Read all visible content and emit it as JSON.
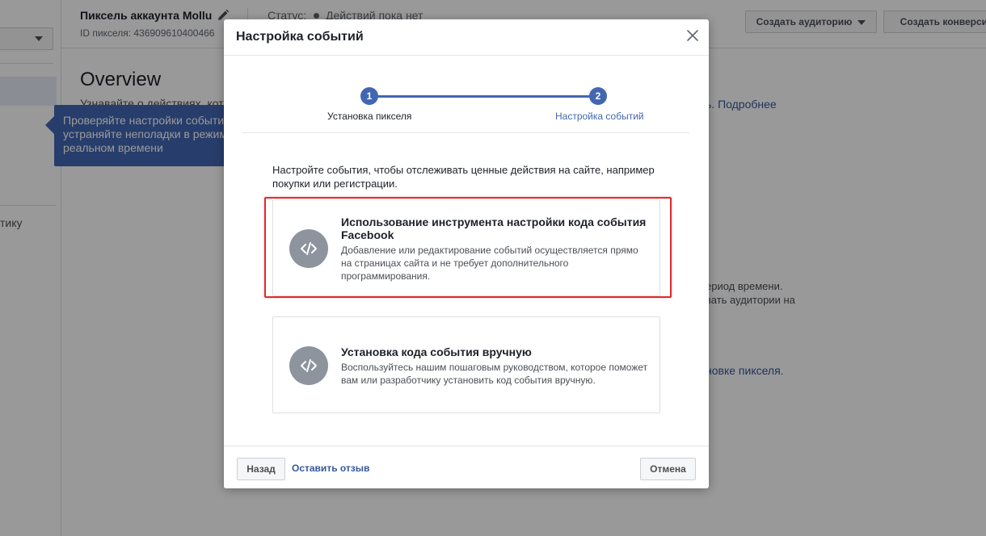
{
  "background": {
    "sidebar": {
      "partial_item": "тику"
    },
    "header": {
      "pixel_name": "Пиксель аккаунта Mollu",
      "pixel_id": "ID пикселя: 436909610400466",
      "status_label": "Статус:",
      "status_value": "Действий пока нет",
      "create_audience_button": "Создать аудиторию",
      "create_conversion_button": "Создать конверсию"
    },
    "overview": {
      "title": "Overview",
      "description_partial": "Узнавайте о действиях, кот"
    },
    "right_column": {
      "learn_more": "ь. Подробнее",
      "period_text": "ериод времени.",
      "audience_text": "вать аудитории на",
      "pixel_setup_text": "новке пикселя."
    },
    "tooltip": {
      "lines": [
        "Проверяйте настройки событи",
        "устраняйте неполадки в режим",
        "реальном времени"
      ]
    }
  },
  "modal": {
    "title": "Настройка событий",
    "steps": [
      {
        "number": "1",
        "label": "Установка пикселя"
      },
      {
        "number": "2",
        "label": "Настройка событий"
      }
    ],
    "intro": "Настройте события, чтобы отслеживать ценные действия на сайте, например покупки или регистрации.",
    "options": [
      {
        "title": "Использование инструмента настройки кода события Facebook",
        "description": "Добавление или редактирование событий осуществляется прямо на страницах сайта и не требует дополнительного программирования.",
        "icon": "code-icon"
      },
      {
        "title": "Установка кода события вручную",
        "description": "Воспользуйтесь нашим пошаговым руководством, которое поможет вам или разработчику установить код события вручную.",
        "icon": "code-icon"
      }
    ],
    "footer": {
      "back_button": "Назад",
      "feedback_link": "Оставить отзыв",
      "cancel_button": "Отмена"
    }
  },
  "colors": {
    "accent": "#4267b2",
    "link": "#365899",
    "highlight": "#e02b2b",
    "icon_circle": "#8d949e"
  }
}
